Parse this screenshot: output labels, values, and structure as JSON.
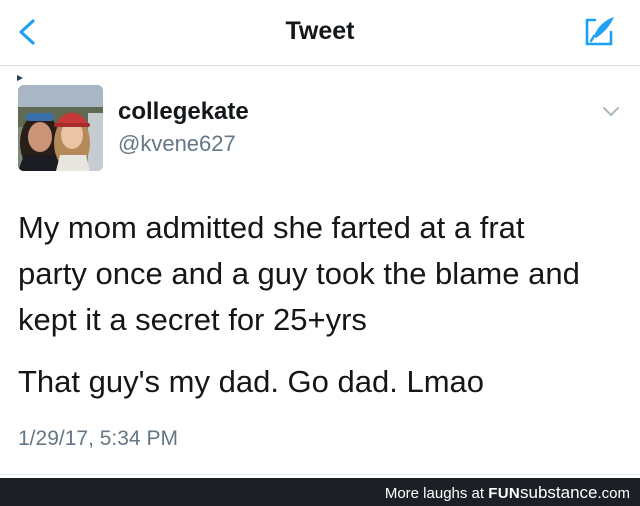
{
  "nav": {
    "title": "Tweet",
    "back_icon": "chevron-left-icon",
    "compose_icon": "compose-tweet-icon"
  },
  "user": {
    "display_name": "collegekate",
    "handle": "@kvene627",
    "avatar_desc": "photo-avatar"
  },
  "tweet": {
    "line1": "My mom admitted she farted at a frat",
    "line2": "party once and a guy took the blame and",
    "line3": "kept it a secret for 25+yrs",
    "line4": "That guy's my dad. Go dad. Lmao",
    "timestamp": "1/29/17, 5:34 PM"
  },
  "footer": {
    "prefix": "More laughs at",
    "brand_bold": "FUN",
    "brand_rest": "substance",
    "brand_tld": ".com"
  },
  "colors": {
    "accent": "#1da1f2",
    "text": "#14171a",
    "secondary": "#657786",
    "footer_bg": "#1c1f26"
  }
}
